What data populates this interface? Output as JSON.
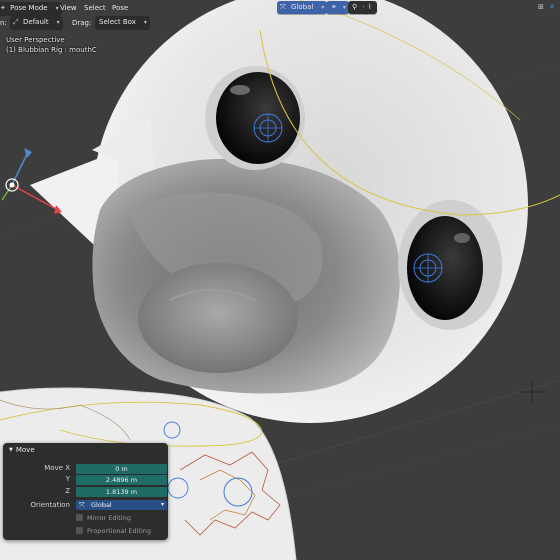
{
  "header": {
    "mode_label": "Pose Mode",
    "menu": [
      "View",
      "Select",
      "Pose"
    ],
    "orientation_prefix": "n:",
    "orientation_value": "Default",
    "drag_label": "Drag:",
    "drag_value": "Select Box",
    "transform_orientation": "Global",
    "icon_names": [
      "pose-mode-icon",
      "transform-orientation-icon",
      "link-icon",
      "snap-icon",
      "proportional-icon",
      "gizmo-icon"
    ]
  },
  "viewport": {
    "perspective_label": "User Perspective",
    "object_label": "(1) Blubbian Rig : mouthC"
  },
  "operator_panel": {
    "title": "Move",
    "move_x_label": "Move X",
    "y_label": "Y",
    "z_label": "Z",
    "x_value": "0 m",
    "y_value": "2.4896 m",
    "z_value": "1.8139 m",
    "orientation_label": "Orientation",
    "orientation_value": "Global",
    "mirror_label": "Mirror Editing",
    "proportional_label": "Proportional Editing"
  },
  "colors": {
    "background": "#3d3d3d",
    "panel_field": "#1f6b66",
    "select_field": "#2a4f86",
    "header_button": "#3f63a8",
    "gizmo_x": "#e8414a",
    "gizmo_y": "#4f8bd0"
  }
}
